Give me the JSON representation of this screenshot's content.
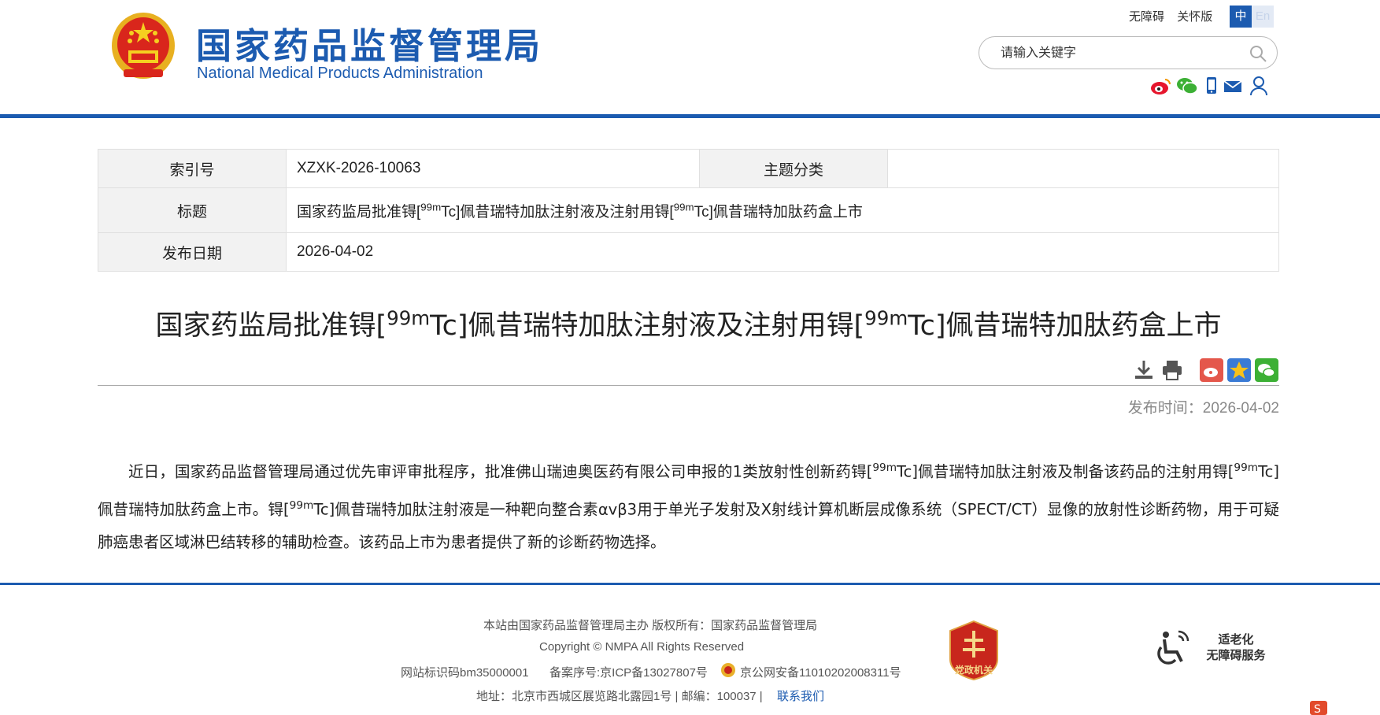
{
  "header": {
    "site_title_cn": "国家药品监督管理局",
    "site_title_en": "National Medical Products Administration",
    "top_links": [
      "无障碍",
      "关怀版"
    ],
    "lang_cn": "中",
    "lang_en": "En",
    "search_placeholder": "请输入关键字",
    "social_icons": [
      "weibo-icon",
      "wechat-icon",
      "mobile-icon",
      "mail-icon",
      "user-icon"
    ],
    "brand_color": "#1c5bb0"
  },
  "info": {
    "index_label": "索引号",
    "index_value": "XZXK-2026-10063",
    "topic_label": "主题分类",
    "topic_value": "",
    "title_label": "标题",
    "title_a": "国家药监局批准锝[",
    "title_sup1": "99m",
    "title_b": "Tc]佩昔瑞特加肽注射液及注射用锝[",
    "title_sup2": "99m",
    "title_c": "Tc]佩昔瑞特加肽药盒上市",
    "date_label": "发布日期",
    "date_value": "2026-04-02"
  },
  "article": {
    "title_a": "国家药监局批准锝[",
    "title_sup1": "99m",
    "title_b": "Tc]佩昔瑞特加肽注射液及注射用锝[",
    "title_sup2": "99m",
    "title_c": "Tc]佩昔瑞特加肽药盒上市",
    "tools": [
      "download-icon",
      "print-icon",
      "share-weibo-icon",
      "favorite-icon",
      "share-wechat-icon"
    ],
    "pubtime_label": "发布时间：",
    "pubtime_value": "2026-04-02",
    "p1": "近日，国家药品监督管理局通过优先审评审批程序，批准佛山瑞迪奥医药有限公司申报的1类放射性创新药锝[",
    "sup1": "99m",
    "p2": "Tc]佩昔瑞特加肽注射液及制备该药品的注射用锝[",
    "sup2": "99m",
    "p3": "Tc]佩昔瑞特加肽药盒上市。锝[",
    "sup3": "99m",
    "p4": "Tc]佩昔瑞特加肽注射液是一种靶向整合素αvβ3用于单光子发射及X射线计算机断层成像系统（SPECT/CT）显像的放射性诊断药物，用于可疑肺癌患者区域淋巴结转移的辅助检查。该药品上市为患者提供了新的诊断药物选择。"
  },
  "footer": {
    "line1": "本站由国家药品监督管理局主办 版权所有：国家药品监督管理局",
    "line2": "Copyright © NMPA All Rights Reserved",
    "site_id": "网站标识码bm35000001",
    "icp": "备案序号:京ICP备13027807号",
    "police": "京公网安备11010202008311号",
    "address": "地址：北京市西城区展览路北露园1号 | 邮编：100037 |",
    "contact": "联系我们",
    "badge_text": "党政机关",
    "access_line1": "适老化",
    "access_line2": "无障碍服务"
  }
}
